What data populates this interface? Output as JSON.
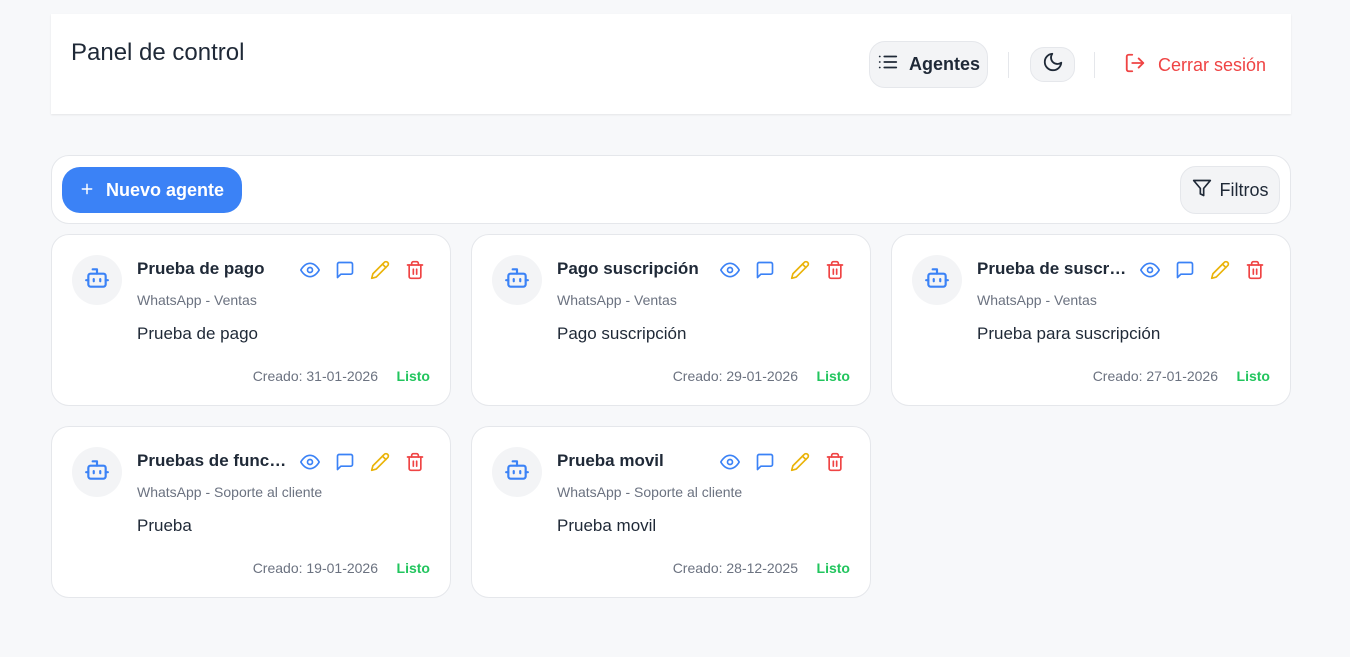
{
  "header": {
    "title": "Panel de control",
    "agents_label": "Agentes",
    "logout_label": "Cerrar sesión"
  },
  "toolbar": {
    "new_agent_label": "Nuevo agente",
    "filters_label": "Filtros"
  },
  "cards": [
    {
      "name": "Prueba de pago",
      "subtitle": "WhatsApp - Ventas",
      "description": "Prueba de pago",
      "created": "Creado: 31-01-2026",
      "status": "Listo"
    },
    {
      "name": "Pago suscripción",
      "subtitle": "WhatsApp - Ventas",
      "description": "Pago suscripción",
      "created": "Creado: 29-01-2026",
      "status": "Listo"
    },
    {
      "name": "Prueba de suscripción",
      "subtitle": "WhatsApp - Ventas",
      "description": "Prueba para suscripción",
      "created": "Creado: 27-01-2026",
      "status": "Listo"
    },
    {
      "name": "Pruebas de funcionamiento",
      "subtitle": "WhatsApp - Soporte al cliente",
      "description": "Prueba",
      "created": "Creado: 19-01-2026",
      "status": "Listo"
    },
    {
      "name": "Prueba movil",
      "subtitle": "WhatsApp - Soporte al cliente",
      "description": "Prueba movil",
      "created": "Creado: 28-12-2025",
      "status": "Listo"
    }
  ],
  "icons": {
    "list": "list-icon",
    "moon": "moon-icon",
    "logout": "logout-icon",
    "plus": "plus-icon",
    "filter": "filter-icon",
    "bot": "bot-icon",
    "view": "eye-icon",
    "chat": "chat-icon",
    "edit": "pencil-icon",
    "delete": "trash-icon"
  },
  "colors": {
    "primary": "#3b82f6",
    "danger": "#ef4444",
    "edit": "#eab308",
    "success": "#22c55e"
  }
}
